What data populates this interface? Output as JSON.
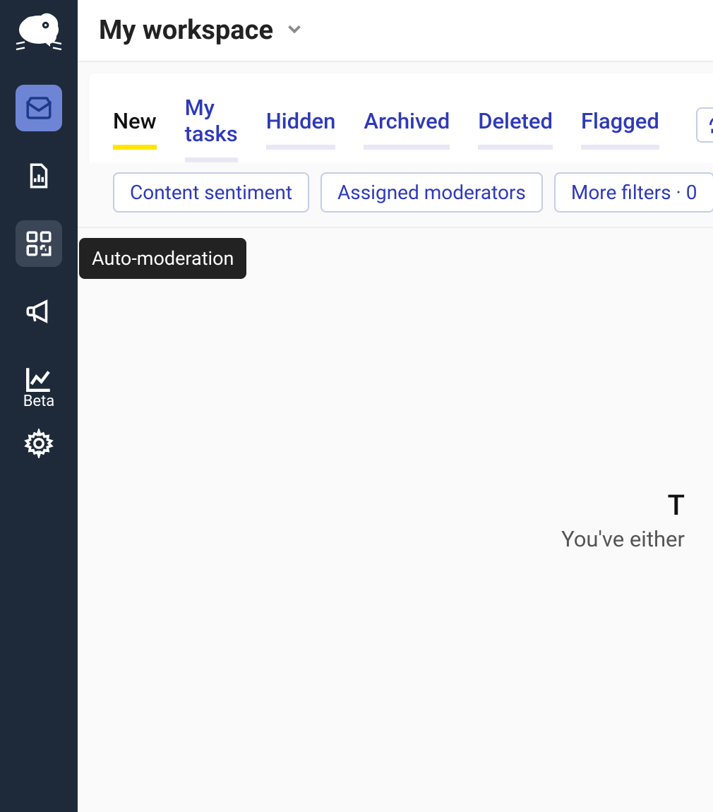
{
  "header": {
    "workspace_title": "My workspace"
  },
  "sidebar": {
    "items": [
      {
        "name": "inbox",
        "label": "Inbox"
      },
      {
        "name": "reports",
        "label": "Reports"
      },
      {
        "name": "auto-moderation",
        "label": "Auto-moderation"
      },
      {
        "name": "announcements",
        "label": "Announcements"
      },
      {
        "name": "analytics",
        "label": "Analytics",
        "badge": "Beta"
      },
      {
        "name": "settings",
        "label": "Settings"
      }
    ],
    "beta_label": "Beta"
  },
  "tooltip": {
    "text": "Auto-moderation"
  },
  "tabs": [
    {
      "label": "New",
      "active": true
    },
    {
      "label": "My tasks",
      "active": false
    },
    {
      "label": "Hidden",
      "active": false
    },
    {
      "label": "Archived",
      "active": false
    },
    {
      "label": "Deleted",
      "active": false
    },
    {
      "label": "Flagged",
      "active": false
    }
  ],
  "filters": {
    "sentiment": "Content sentiment",
    "assigned": "Assigned moderators",
    "more": "More filters · 0"
  },
  "empty": {
    "heading_partial": "T",
    "sub_partial": "You've either"
  }
}
